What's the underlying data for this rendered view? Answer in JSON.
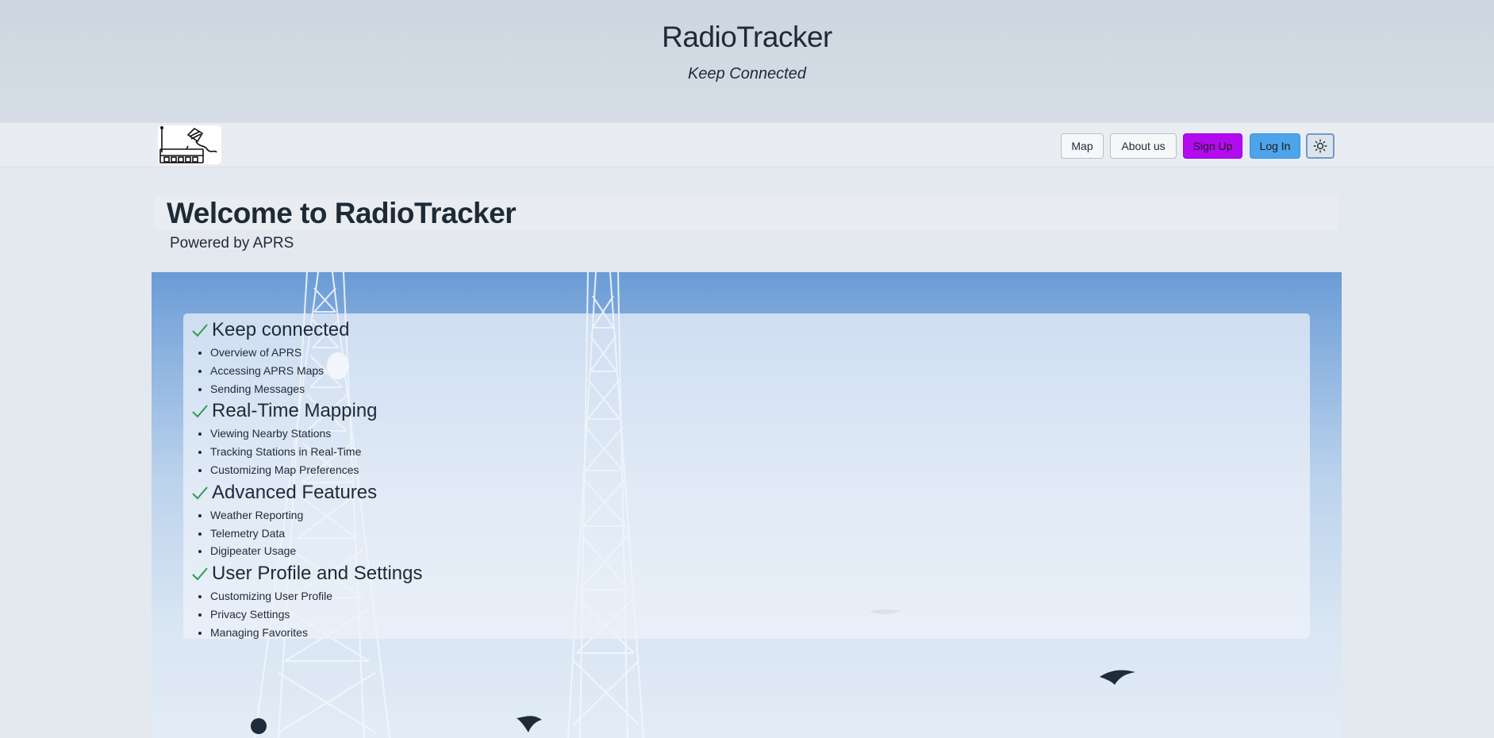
{
  "header": {
    "title": "RadioTracker",
    "subtitle": "Keep Connected"
  },
  "nav": {
    "logo_icon": "radio-transceiver-icon",
    "map_label": "Map",
    "about_label": "About us",
    "signup_label": "Sign Up",
    "login_label": "Log In",
    "theme_icon": "sun-icon",
    "colors": {
      "signup": "#b30bf0",
      "login": "#4ea4ea"
    }
  },
  "welcome": {
    "title": "Welcome to RadioTracker",
    "powered_by": "Powered by APRS"
  },
  "features": {
    "check_color": "#2e9e4f",
    "sections": [
      {
        "heading": "Keep connected",
        "items": [
          "Overview of APRS",
          "Accessing APRS Maps",
          "Sending Messages"
        ]
      },
      {
        "heading": "Real-Time Mapping",
        "items": [
          "Viewing Nearby Stations",
          "Tracking Stations in Real-Time",
          "Customizing Map Preferences"
        ]
      },
      {
        "heading": "Advanced Features",
        "items": [
          "Weather Reporting",
          "Telemetry Data",
          "Digipeater Usage"
        ]
      },
      {
        "heading": "User Profile and Settings",
        "items": [
          "Customizing User Profile",
          "Privacy Settings",
          "Managing Favorites"
        ]
      }
    ]
  }
}
